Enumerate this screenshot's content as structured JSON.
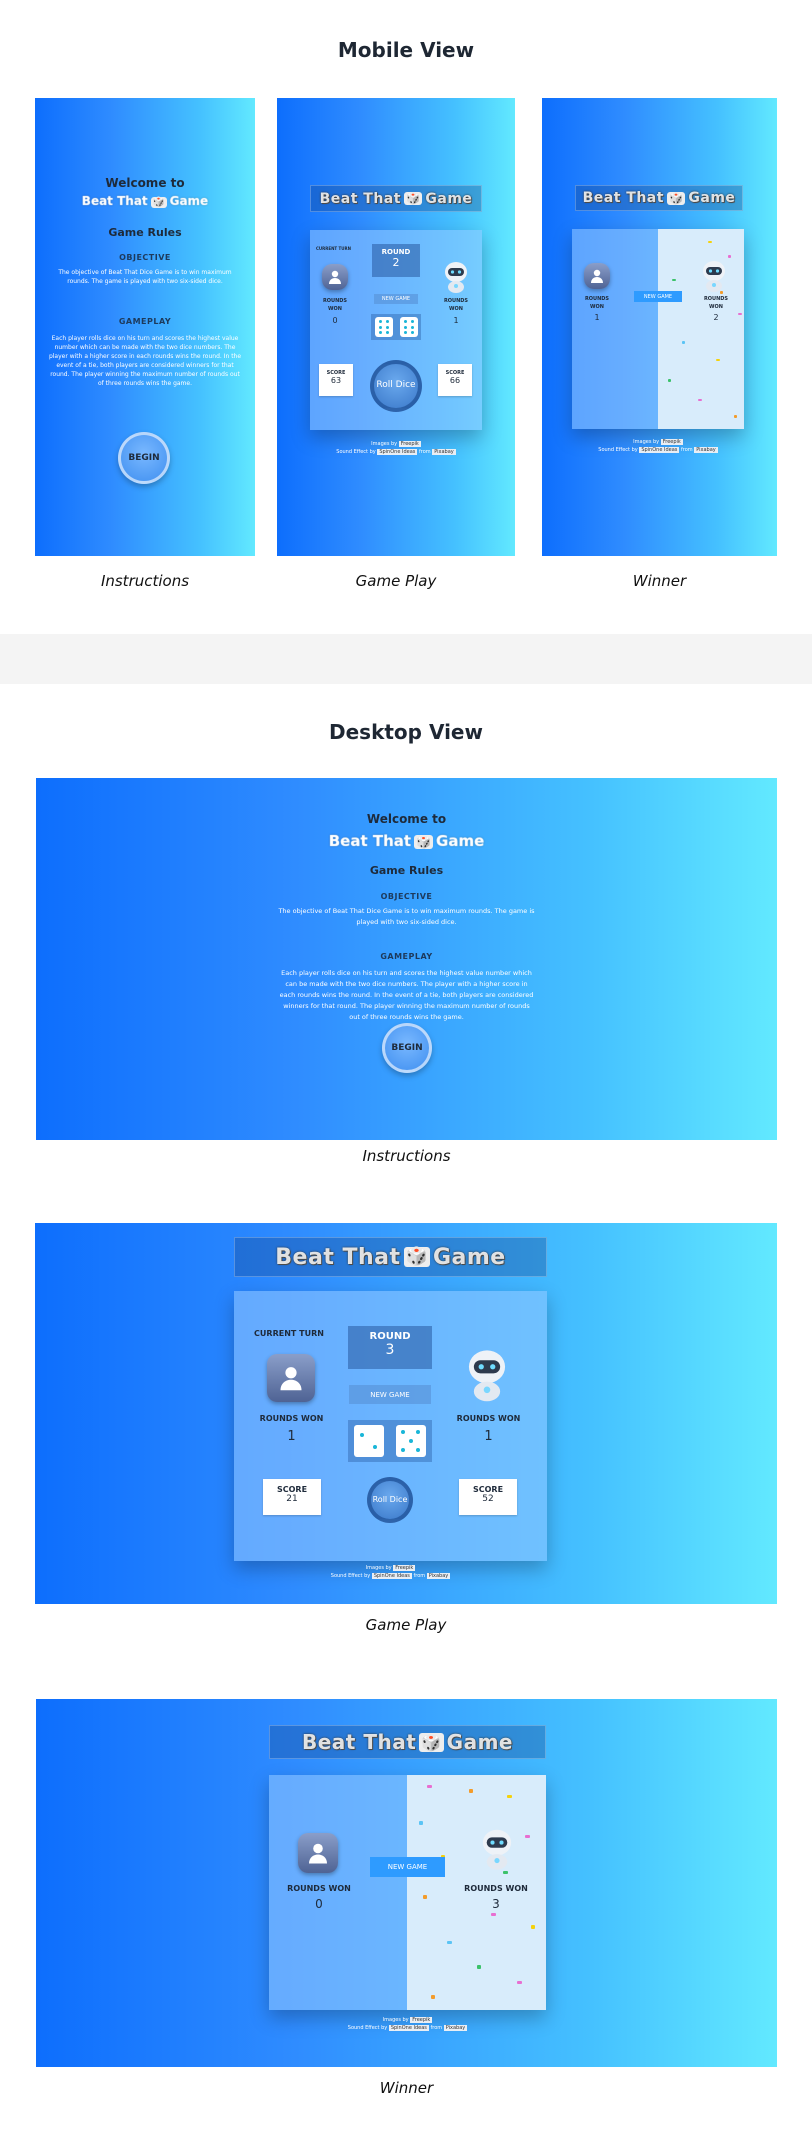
{
  "headings": {
    "mobile": "Mobile View",
    "desktop": "Desktop View"
  },
  "captions": {
    "instructions": "Instructions",
    "game_play": "Game Play",
    "winner": "Winner"
  },
  "game_title": {
    "part1": "Beat That",
    "dice": "🎲",
    "part2": "Game"
  },
  "instructions": {
    "welcome": "Welcome to",
    "rules_title": "Game Rules",
    "objective_title": "OBJECTIVE",
    "objective_text": "The objective of Beat That Dice Game is to win maximum rounds. The game is played with two six-sided dice.",
    "gameplay_title": "GAMEPLAY",
    "gameplay_text": "Each player rolls dice on his turn and scores the highest value number which can be made with the two dice numbers. The player with a higher score in each rounds wins the round. In the event of a tie, both players are considered winners for that round. The player winning the maximum number of rounds out of three rounds wins the game.",
    "begin": "BEGIN"
  },
  "labels": {
    "current_turn": "CURRENT TURN",
    "round": "ROUND",
    "rounds_won": "ROUNDS WON",
    "new_game": "NEW GAME",
    "score": "SCORE",
    "roll_dice": "Roll Dice"
  },
  "mobile_game": {
    "round": "2",
    "player_rounds": "0",
    "bot_rounds": "1",
    "player_score": "63",
    "bot_score": "66",
    "dice": [
      6,
      6
    ]
  },
  "mobile_winner": {
    "player_rounds": "1",
    "bot_rounds": "2"
  },
  "desktop_game": {
    "round": "3",
    "player_rounds": "1",
    "bot_rounds": "1",
    "player_score": "21",
    "bot_score": "52",
    "dice": [
      2,
      5
    ]
  },
  "desktop_winner": {
    "player_rounds": "0",
    "bot_rounds": "3"
  },
  "credits": {
    "images_by": "Images by",
    "images_source": "Freepik",
    "sound_by": "Sound Effect by",
    "sound_author": "SpinOne Ideas",
    "from": "from",
    "sound_source": "Pixabay"
  },
  "colors": {
    "gradient_start": "#0d6efd",
    "gradient_end": "#62e9ff",
    "accent": "#2e9bff"
  }
}
